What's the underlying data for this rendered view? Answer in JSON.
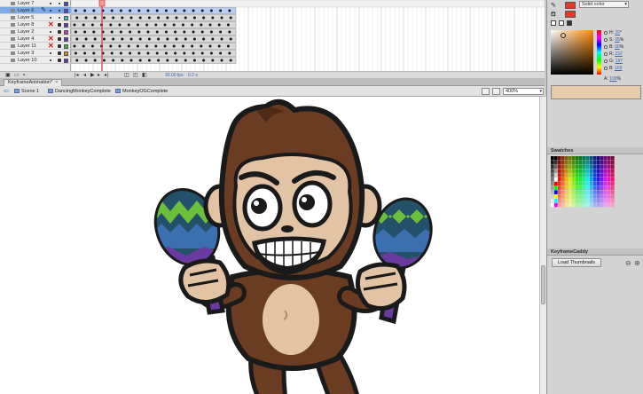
{
  "timeline": {
    "layers": [
      {
        "name": "Layer 7",
        "selected": false,
        "x": false,
        "lock": false,
        "color": "#3b4fd6"
      },
      {
        "name": "Layer 6",
        "selected": true,
        "x": false,
        "lock": false,
        "color": "#3b4fd6",
        "pen": true
      },
      {
        "name": "Layer 5",
        "selected": false,
        "x": false,
        "lock": false,
        "color": "#36c1c9"
      },
      {
        "name": "Layer 8",
        "selected": false,
        "x": true,
        "lock": true,
        "color": "#6a2fb8"
      },
      {
        "name": "Layer 2",
        "selected": false,
        "x": false,
        "lock": true,
        "color": "#c037b5"
      },
      {
        "name": "Layer 4",
        "selected": false,
        "x": true,
        "lock": true,
        "color": "#6a2fb8"
      },
      {
        "name": "Layer 11",
        "selected": false,
        "x": true,
        "lock": true,
        "color": "#38b041"
      },
      {
        "name": "Layer 3",
        "selected": false,
        "x": false,
        "lock": true,
        "color": "#e0851f"
      },
      {
        "name": "Layer 10",
        "selected": false,
        "x": false,
        "lock": true,
        "color": "#6a2fb8"
      }
    ],
    "bottom": {
      "frame_rate": "30.00 fps",
      "elapsed": "0.2 s"
    }
  },
  "document": {
    "tab_label": "KeyframeAnimation*",
    "close_glyph": "×"
  },
  "edit_bar": {
    "back_glyph": "⇦",
    "crumbs": [
      "Scene 1",
      "DancingMonkeyComplete",
      "MonkeyOGComplete"
    ],
    "zoom": "400%",
    "chevron": "▾"
  },
  "color_panel": {
    "type": "Solid color",
    "stroke_color": "#e23a26",
    "fill_color": "#e23a26",
    "chevron": "▾",
    "hsb": [
      {
        "label": "H:",
        "value": "29",
        "unit": "°"
      },
      {
        "label": "S:",
        "value": "35",
        "unit": "%"
      },
      {
        "label": "B:",
        "value": "90",
        "unit": "%"
      },
      {
        "label": "R:",
        "value": "232",
        "unit": ""
      },
      {
        "label": "G:",
        "value": "197",
        "unit": ""
      },
      {
        "label": "B:",
        "value": "169",
        "unit": ""
      }
    ],
    "alpha": {
      "label": "A:",
      "value": "100",
      "unit": "%"
    },
    "preview_color": "#e8c9a9"
  },
  "swatches_panel": {
    "title": "Swatches"
  },
  "keyframe_panel": {
    "title": "KeyframeCaddy",
    "load_button": "Load Thumbnails"
  },
  "icons": [
    "pencil-icon",
    "bucket-icon",
    "eye-icon",
    "lock-icon",
    "zoom-in-icon",
    "zoom-out-icon",
    "back-arrow-icon",
    "scene-icon",
    "clip-icon"
  ]
}
